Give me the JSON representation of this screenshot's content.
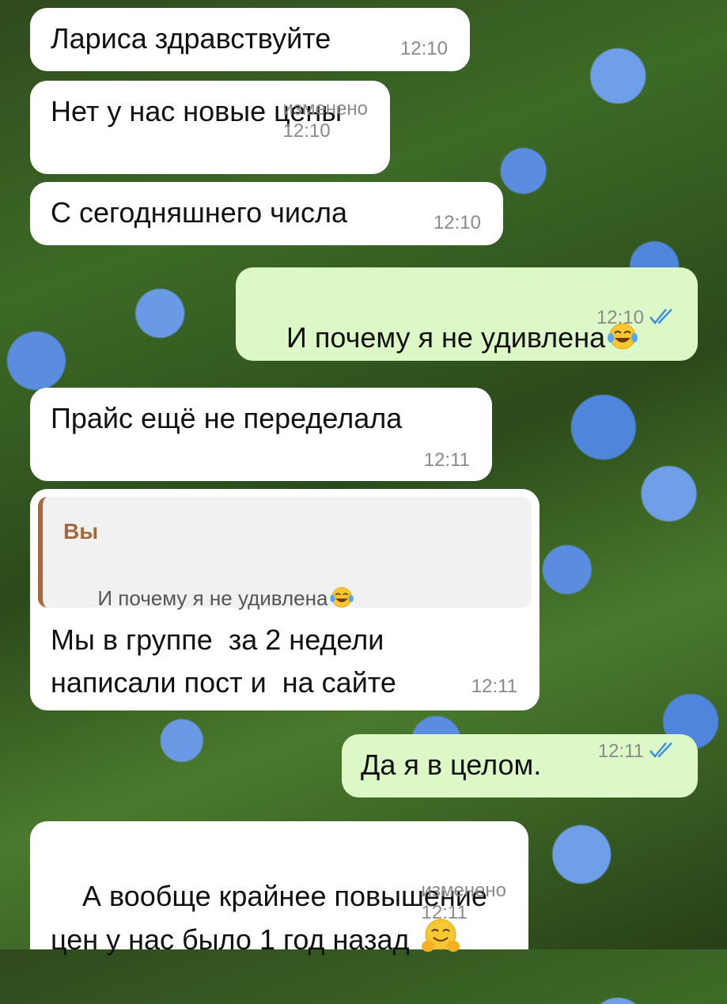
{
  "messages": [
    {
      "text": "Лариса здравствуйте",
      "time": "12:10",
      "edited": ""
    },
    {
      "text": "Нет у нас новые цены",
      "time": "12:10",
      "edited": "изменено"
    },
    {
      "text": "С сегодняшнего числа",
      "time": "12:10",
      "edited": ""
    },
    {
      "text": "И почему я не удивлена",
      "time": "12:10",
      "edited": "",
      "emoji": "laughing-tears-icon",
      "status": "read-double-check-icon"
    },
    {
      "text": "Прайс ещё не переделала",
      "time": "12:11",
      "edited": ""
    },
    {
      "reply_name": "Вы",
      "reply_text": "И почему я не удивлена",
      "text": "Мы в группе  за 2 недели\nнаписали пост и  на сайте",
      "time": "12:11",
      "edited": ""
    },
    {
      "text": "Да я в целом.",
      "time": "12:11",
      "edited": "",
      "status": "read-double-check-icon"
    },
    {
      "text": "А вообще крайнее повышение\nцен у нас было 1 год назад",
      "time": "12:11",
      "edited": "изменено",
      "emoji": "hugging-face-icon"
    }
  ],
  "colors": {
    "incoming": "#ffffff",
    "outgoing": "#dcf8c6",
    "read_check": "#3b8fe0",
    "reply_accent": "#a5673f"
  }
}
